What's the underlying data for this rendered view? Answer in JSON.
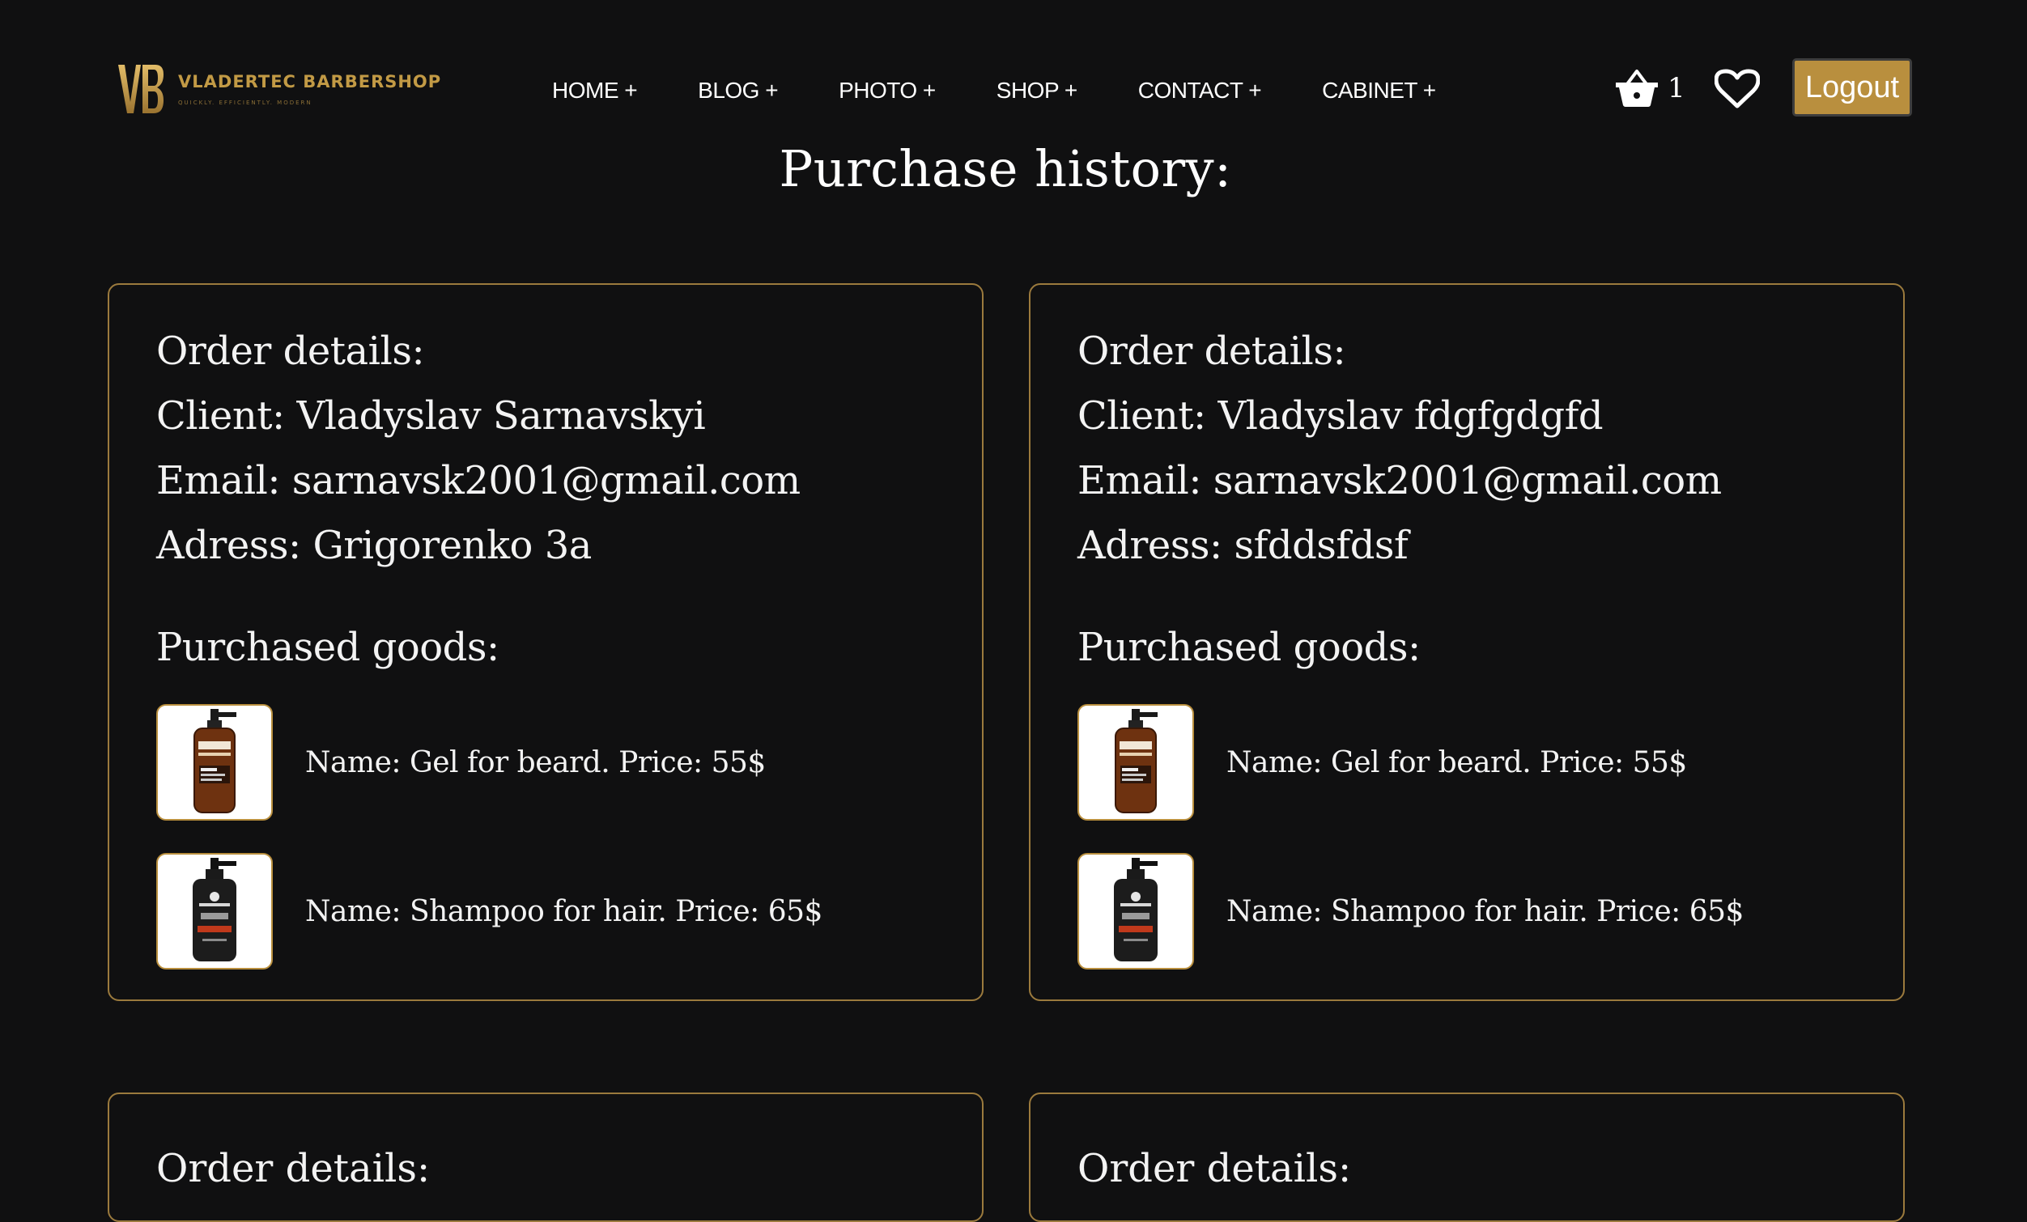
{
  "brand": {
    "name": "VLADERTEC BARBERSHOP",
    "tagline": "QUICKLY. EFFICIENTLY. MODERN",
    "monogram": "VB",
    "accent_color": "#c29a45"
  },
  "nav": {
    "items": [
      {
        "label": "HOME +"
      },
      {
        "label": "BLOG +"
      },
      {
        "label": "PHOTO +"
      },
      {
        "label": "SHOP +"
      },
      {
        "label": "CONTACT +"
      },
      {
        "label": "CABINET +"
      }
    ]
  },
  "header": {
    "basket_icon": "basket-icon",
    "basket_count": "1",
    "favorites_icon": "heart-icon",
    "logout_label": "Logout",
    "logout_color": "#b98f3e"
  },
  "page": {
    "title": "Purchase history:"
  },
  "orders": [
    {
      "details_title": "Order details:",
      "client": "Client: Vladyslav Sarnavskyi",
      "email": "Email: sarnavsk2001@gmail.com",
      "address": "Adress: Grigorenko 3a",
      "goods_title": "Purchased goods:",
      "goods": [
        {
          "text": "Name: Gel for beard. Price: 55$",
          "image": "beard-gel-bottle"
        },
        {
          "text": "Name: Shampoo for hair. Price: 65$",
          "image": "hair-shampoo-bottle"
        }
      ]
    },
    {
      "details_title": "Order details:",
      "client": "Client: Vladyslav fdgfgdgfd",
      "email": "Email: sarnavsk2001@gmail.com",
      "address": "Adress: sfddsfdsf",
      "goods_title": "Purchased goods:",
      "goods": [
        {
          "text": "Name: Gel for beard. Price: 55$",
          "image": "beard-gel-bottle"
        },
        {
          "text": "Name: Shampoo for hair. Price: 65$",
          "image": "hair-shampoo-bottle"
        }
      ]
    },
    {
      "details_title": "Order details:"
    },
    {
      "details_title": "Order details:"
    }
  ]
}
